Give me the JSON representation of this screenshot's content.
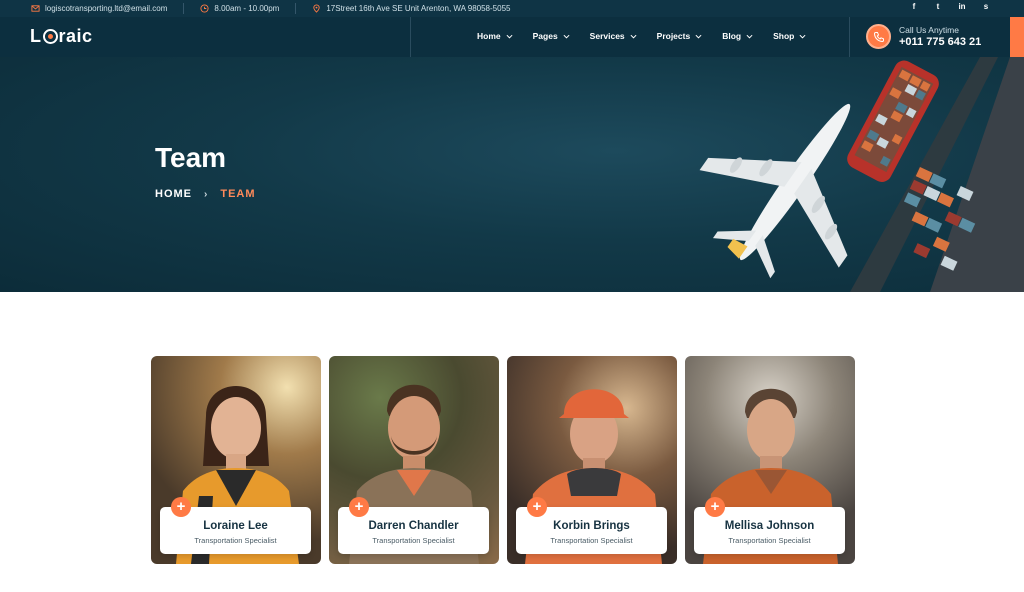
{
  "topbar": {
    "email": "logiscotransporting.ltd@email.com",
    "hours": "8.00am - 10.00pm",
    "address": "17Street 16th Ave SE Unit Arenton, WA 98058-5055",
    "socials": [
      {
        "icon": "facebook-icon",
        "label": "f"
      },
      {
        "icon": "twitter-icon",
        "label": "t"
      },
      {
        "icon": "linkedin-icon",
        "label": "in"
      },
      {
        "icon": "skype-icon",
        "label": "s"
      }
    ]
  },
  "header": {
    "logo_left": "L",
    "logo_right": "raic",
    "nav": [
      "Home",
      "Pages",
      "Services",
      "Projects",
      "Blog",
      "Shop"
    ],
    "call_label": "Call Us Anytime",
    "call_number": "+011 775 643 21"
  },
  "hero": {
    "title": "Team",
    "breadcrumb_home": "HOME",
    "breadcrumb_current": "TEAM"
  },
  "team": [
    {
      "name": "Loraine Lee",
      "role": "Transportation Specialist"
    },
    {
      "name": "Darren Chandler",
      "role": "Transportation Specialist"
    },
    {
      "name": "Korbin Brings",
      "role": "Transportation Specialist"
    },
    {
      "name": "Mellisa Johnson",
      "role": "Transportation Specialist"
    }
  ],
  "colors": {
    "accent": "#ff7a45",
    "dark": "#0c2f3f",
    "hero": "#123948"
  }
}
